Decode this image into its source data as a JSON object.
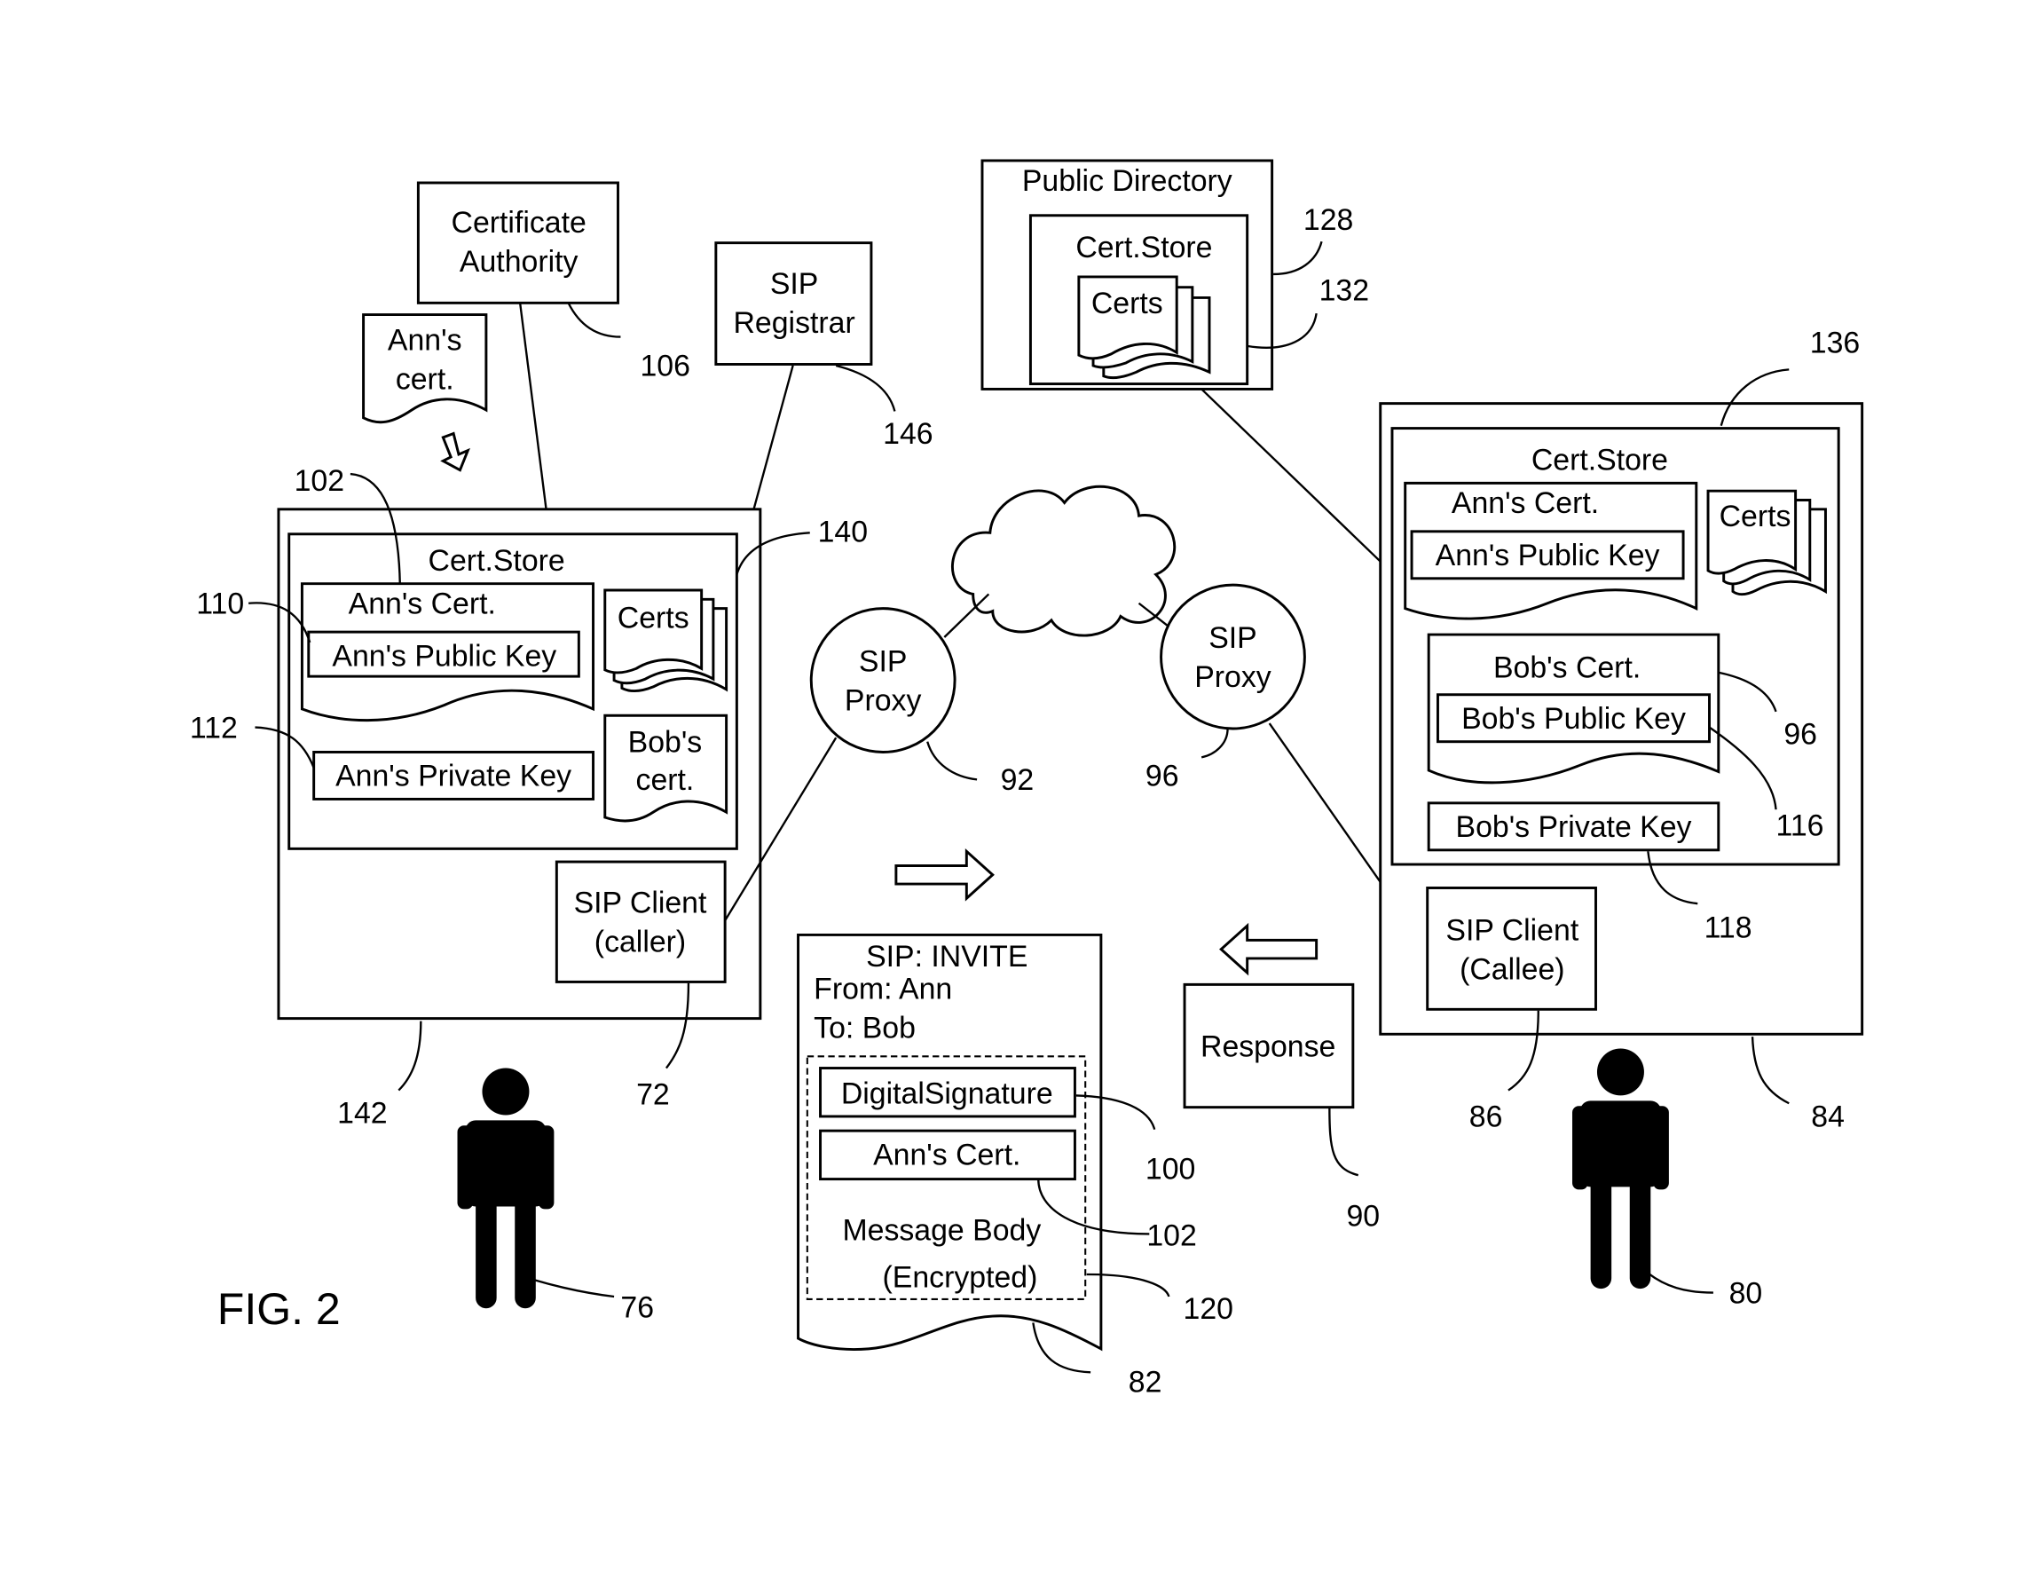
{
  "figure": {
    "title": "FIG. 2",
    "certificate_authority": {
      "line1": "Certificate",
      "line2": "Authority",
      "ref": "106"
    },
    "anns_cert_doc": {
      "line1": "Ann's",
      "line2": "cert."
    },
    "sip_registrar": {
      "line1": "SIP",
      "line2": "Registrar",
      "ref": "146"
    },
    "public_directory": {
      "title": "Public Directory",
      "ref": "128",
      "cert_store": {
        "title": "Cert.Store",
        "certs": "Certs",
        "ref": "132"
      }
    },
    "caller_device": {
      "ref": "142",
      "cert_store": {
        "title": "Cert.Store",
        "ref": "140",
        "anns_cert": {
          "title": "Ann's Cert.",
          "ref": "102",
          "public_key": "Ann's Public Key",
          "public_key_ref": "110"
        },
        "private_key": {
          "label": "Ann's Private Key",
          "ref": "112"
        },
        "certs": "Certs",
        "bobs_cert": {
          "line1": "Bob's",
          "line2": "cert."
        }
      },
      "sip_client": {
        "line1": "SIP Client",
        "line2": "(caller)",
        "ref": "72"
      }
    },
    "callee_device": {
      "ref": "84",
      "cert_store": {
        "title": "Cert.Store",
        "ref": "136",
        "anns_cert": {
          "title": "Ann's Cert.",
          "public_key": "Ann's Public Key"
        },
        "certs": "Certs",
        "bobs_cert": {
          "title": "Bob's Cert.",
          "ref": "96",
          "public_key": "Bob's Public Key",
          "public_key_ref": "116"
        },
        "private_key": {
          "label": "Bob's Private Key",
          "ref": "118"
        }
      },
      "sip_client": {
        "line1": "SIP Client",
        "line2": "(Callee)",
        "ref": "86"
      }
    },
    "proxy_left": {
      "line1": "SIP",
      "line2": "Proxy",
      "ref": "92"
    },
    "proxy_right": {
      "line1": "SIP",
      "line2": "Proxy",
      "ref": "96"
    },
    "invite_message": {
      "ref": "82",
      "line1": "SIP: INVITE",
      "line2": "From: Ann",
      "line3": "To: Bob",
      "signature": {
        "label": "DigitalSignature",
        "ref": "100"
      },
      "cert": {
        "label": "Ann's Cert.",
        "ref": "102"
      },
      "body": {
        "line1": "Message Body",
        "line2": "(Encrypted)",
        "ref": "120"
      }
    },
    "response": {
      "label": "Response",
      "ref": "90"
    },
    "user_ann": {
      "ref": "76"
    },
    "user_bob": {
      "ref": "80"
    }
  }
}
